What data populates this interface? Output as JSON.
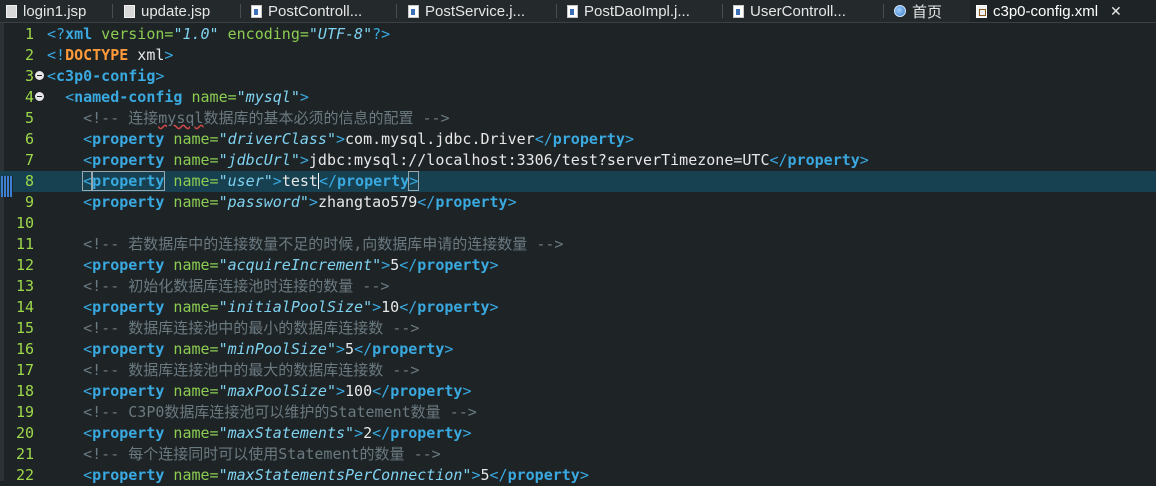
{
  "tabs": [
    {
      "label": "login1.jsp",
      "icon": "jsp-file-icon",
      "active": false
    },
    {
      "label": "update.jsp",
      "icon": "jsp-file-icon",
      "active": false
    },
    {
      "label": "PostControll...",
      "icon": "java-file-icon",
      "active": false
    },
    {
      "label": "PostService.j...",
      "icon": "java-file-icon",
      "active": false
    },
    {
      "label": "PostDaoImpl.j...",
      "icon": "java-file-icon",
      "active": false
    },
    {
      "label": "UserControll...",
      "icon": "java-file-icon",
      "active": false
    },
    {
      "label": "首页",
      "icon": "globe-icon",
      "active": false
    },
    {
      "label": "c3p0-config.xml",
      "icon": "xml-file-icon",
      "active": true
    }
  ],
  "close_symbol": "✕",
  "editor": {
    "current_line": 8,
    "lines": [
      {
        "n": "1",
        "fold": false,
        "tokens": [
          [
            "p",
            "<?"
          ],
          [
            "t",
            "xml"
          ],
          [
            "a",
            " version="
          ],
          [
            "s",
            "\"1.0\""
          ],
          [
            "a",
            " encoding="
          ],
          [
            "s",
            "\"UTF-8\""
          ],
          [
            "p",
            "?>"
          ]
        ]
      },
      {
        "n": "2",
        "fold": false,
        "tokens": [
          [
            "p",
            "<!"
          ],
          [
            "dtd",
            "DOCTYPE"
          ],
          [
            "v",
            " xml"
          ],
          [
            "p",
            ">"
          ]
        ]
      },
      {
        "n": "3",
        "fold": true,
        "tokens": [
          [
            "p",
            "<"
          ],
          [
            "t",
            "c3p0-config"
          ],
          [
            "p",
            ">"
          ]
        ]
      },
      {
        "n": "4",
        "fold": true,
        "tokens": [
          [
            "v",
            "  "
          ],
          [
            "p",
            "<"
          ],
          [
            "t",
            "named-config"
          ],
          [
            "a",
            " name="
          ],
          [
            "s",
            "\"mysql\""
          ],
          [
            "p",
            ">"
          ]
        ]
      },
      {
        "n": "5",
        "fold": false,
        "tokens": [
          [
            "v",
            "    "
          ],
          [
            "c",
            "<!-- 连接"
          ],
          [
            "cw",
            "mysql"
          ],
          [
            "c",
            "数据库的基本必须的信息的配置 -->"
          ]
        ]
      },
      {
        "n": "6",
        "fold": false,
        "tokens": [
          [
            "v",
            "    "
          ],
          [
            "p",
            "<"
          ],
          [
            "t",
            "property"
          ],
          [
            "a",
            " name="
          ],
          [
            "s",
            "\"driverClass\""
          ],
          [
            "p",
            ">"
          ],
          [
            "v",
            "com.mysql.jdbc.Driver"
          ],
          [
            "p",
            "</"
          ],
          [
            "t",
            "property"
          ],
          [
            "p",
            ">"
          ]
        ]
      },
      {
        "n": "7",
        "fold": false,
        "tokens": [
          [
            "v",
            "    "
          ],
          [
            "p",
            "<"
          ],
          [
            "t",
            "property"
          ],
          [
            "a",
            " name="
          ],
          [
            "s",
            "\"jdbcUrl\""
          ],
          [
            "p",
            ">"
          ],
          [
            "v",
            "jdbc:mysql://localhost:3306/test?serverTimezone=UTC"
          ],
          [
            "p",
            "</"
          ],
          [
            "t",
            "property"
          ],
          [
            "p",
            ">"
          ]
        ]
      },
      {
        "n": "8",
        "fold": false,
        "tokens": [
          [
            "v",
            "    "
          ],
          [
            "ph",
            "<"
          ],
          [
            "th",
            "property"
          ],
          [
            "a",
            " name="
          ],
          [
            "s",
            "\"user\""
          ],
          [
            "p",
            ">"
          ],
          [
            "v",
            "test"
          ],
          [
            "caret",
            ""
          ],
          [
            "p",
            "</"
          ],
          [
            "t",
            "property"
          ],
          [
            "ph",
            ">"
          ]
        ]
      },
      {
        "n": "9",
        "fold": false,
        "tokens": [
          [
            "v",
            "    "
          ],
          [
            "p",
            "<"
          ],
          [
            "t",
            "property"
          ],
          [
            "a",
            " name="
          ],
          [
            "s",
            "\"password\""
          ],
          [
            "p",
            ">"
          ],
          [
            "v",
            "zhangtao579"
          ],
          [
            "p",
            "</"
          ],
          [
            "t",
            "property"
          ],
          [
            "p",
            ">"
          ]
        ]
      },
      {
        "n": "10",
        "fold": false,
        "tokens": []
      },
      {
        "n": "11",
        "fold": false,
        "tokens": [
          [
            "v",
            "    "
          ],
          [
            "c",
            "<!-- 若数据库中的连接数量不足的时候,向数据库申请的连接数量 -->"
          ]
        ]
      },
      {
        "n": "12",
        "fold": false,
        "tokens": [
          [
            "v",
            "    "
          ],
          [
            "p",
            "<"
          ],
          [
            "t",
            "property"
          ],
          [
            "a",
            " name="
          ],
          [
            "s",
            "\"acquireIncrement\""
          ],
          [
            "p",
            ">"
          ],
          [
            "v",
            "5"
          ],
          [
            "p",
            "</"
          ],
          [
            "t",
            "property"
          ],
          [
            "p",
            ">"
          ]
        ]
      },
      {
        "n": "13",
        "fold": false,
        "tokens": [
          [
            "v",
            "    "
          ],
          [
            "c",
            "<!-- 初始化数据库连接池时连接的数量 -->"
          ]
        ]
      },
      {
        "n": "14",
        "fold": false,
        "tokens": [
          [
            "v",
            "    "
          ],
          [
            "p",
            "<"
          ],
          [
            "t",
            "property"
          ],
          [
            "a",
            " name="
          ],
          [
            "s",
            "\"initialPoolSize\""
          ],
          [
            "p",
            ">"
          ],
          [
            "v",
            "10"
          ],
          [
            "p",
            "</"
          ],
          [
            "t",
            "property"
          ],
          [
            "p",
            ">"
          ]
        ]
      },
      {
        "n": "15",
        "fold": false,
        "tokens": [
          [
            "v",
            "    "
          ],
          [
            "c",
            "<!-- 数据库连接池中的最小的数据库连接数 -->"
          ]
        ]
      },
      {
        "n": "16",
        "fold": false,
        "tokens": [
          [
            "v",
            "    "
          ],
          [
            "p",
            "<"
          ],
          [
            "t",
            "property"
          ],
          [
            "a",
            " name="
          ],
          [
            "s",
            "\"minPoolSize\""
          ],
          [
            "p",
            ">"
          ],
          [
            "v",
            "5"
          ],
          [
            "p",
            "</"
          ],
          [
            "t",
            "property"
          ],
          [
            "p",
            ">"
          ]
        ]
      },
      {
        "n": "17",
        "fold": false,
        "tokens": [
          [
            "v",
            "    "
          ],
          [
            "c",
            "<!-- 数据库连接池中的最大的数据库连接数 -->"
          ]
        ]
      },
      {
        "n": "18",
        "fold": false,
        "tokens": [
          [
            "v",
            "    "
          ],
          [
            "p",
            "<"
          ],
          [
            "t",
            "property"
          ],
          [
            "a",
            " name="
          ],
          [
            "s",
            "\"maxPoolSize\""
          ],
          [
            "p",
            ">"
          ],
          [
            "v",
            "100"
          ],
          [
            "p",
            "</"
          ],
          [
            "t",
            "property"
          ],
          [
            "p",
            ">"
          ]
        ]
      },
      {
        "n": "19",
        "fold": false,
        "tokens": [
          [
            "v",
            "    "
          ],
          [
            "c",
            "<!-- C3P0数据库连接池可以维护的Statement数量 -->"
          ]
        ]
      },
      {
        "n": "20",
        "fold": false,
        "tokens": [
          [
            "v",
            "    "
          ],
          [
            "p",
            "<"
          ],
          [
            "t",
            "property"
          ],
          [
            "a",
            " name="
          ],
          [
            "s",
            "\"maxStatements\""
          ],
          [
            "p",
            ">"
          ],
          [
            "v",
            "2"
          ],
          [
            "p",
            "</"
          ],
          [
            "t",
            "property"
          ],
          [
            "p",
            ">"
          ]
        ]
      },
      {
        "n": "21",
        "fold": false,
        "tokens": [
          [
            "v",
            "    "
          ],
          [
            "c",
            "<!-- 每个连接同时可以使用Statement的数量 -->"
          ]
        ]
      },
      {
        "n": "22",
        "fold": false,
        "tokens": [
          [
            "v",
            "    "
          ],
          [
            "p",
            "<"
          ],
          [
            "t",
            "property"
          ],
          [
            "a",
            " name="
          ],
          [
            "s",
            "\"maxStatementsPerConnection\""
          ],
          [
            "p",
            ">"
          ],
          [
            "v",
            "5"
          ],
          [
            "p",
            "</"
          ],
          [
            "t",
            "property"
          ],
          [
            "p",
            ">"
          ]
        ]
      }
    ]
  }
}
